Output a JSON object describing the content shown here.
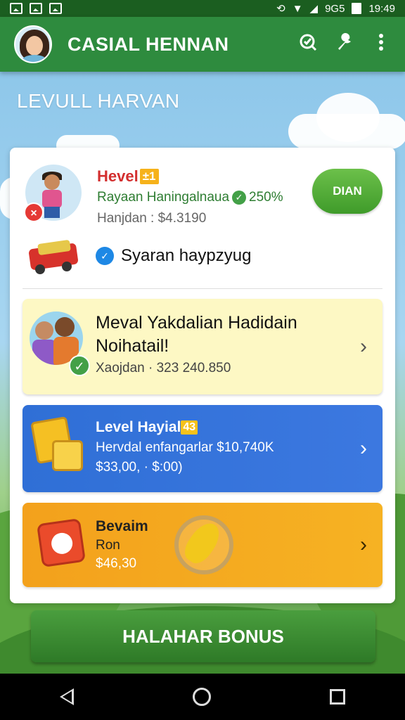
{
  "status_bar": {
    "network_text": "9G5",
    "time": "19:49"
  },
  "app_bar": {
    "title": "CASIAL HENNAN"
  },
  "background_title": "LEVULL HARVAN",
  "profile": {
    "level_title": "Hevel",
    "level_tag": "±1",
    "line2_text": "Rayaan Haningalnaua",
    "line2_percent": "250%",
    "line3": "Hanjdan : $4.3190",
    "claim_button": "DIAN"
  },
  "sync": {
    "label": "Syaran haypzyug"
  },
  "rows": [
    {
      "title": "Meval Yakdalian Hadidain Noihatail!",
      "subtitle": "Xaojdan · 323 240.850"
    },
    {
      "title": "Level Hayial",
      "tag": "43",
      "line2": "Hervdal enfangarlar $10,740K",
      "line3": "$33,00, · $:00)"
    },
    {
      "title": "Bevaim",
      "line2": "Ron",
      "line3": "$46,30"
    }
  ],
  "bonus_button": "HALAHAR BONUS",
  "colors": {
    "app_bar": "#2e8b3e",
    "claim_button": "#4caf3a",
    "blue_row": "#3674dc",
    "orange_row": "#f5a91f",
    "yellow_row": "#fdf8c4"
  }
}
